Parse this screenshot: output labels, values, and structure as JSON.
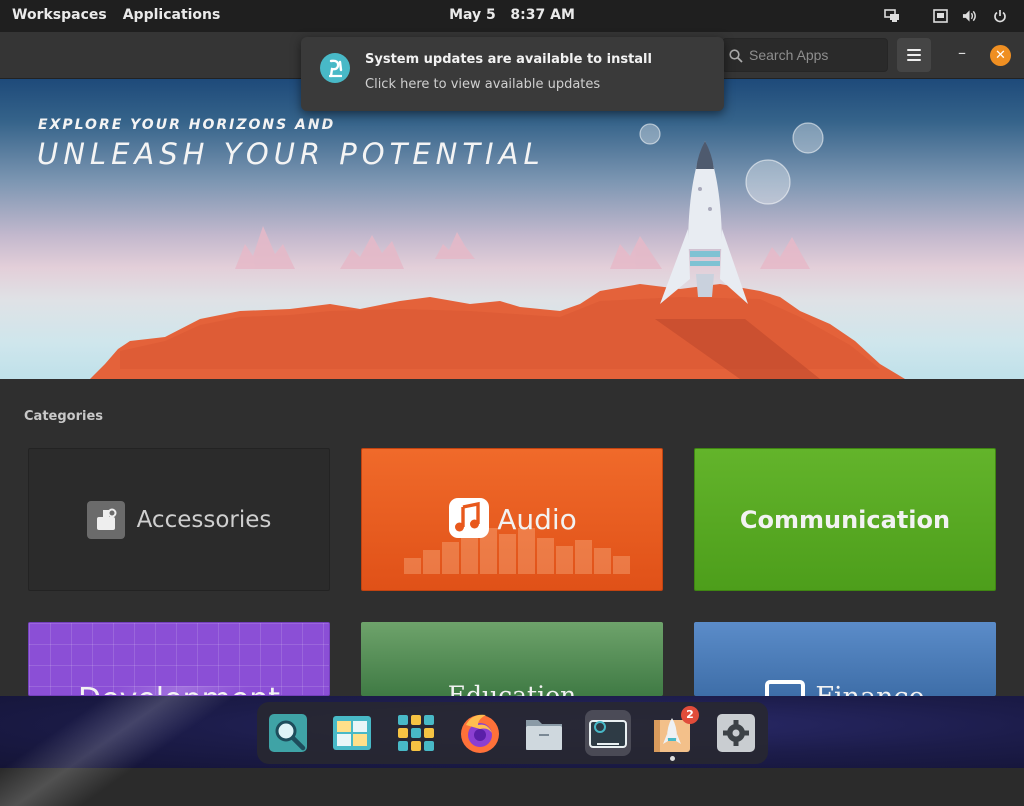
{
  "topbar": {
    "workspaces": "Workspaces",
    "applications": "Applications",
    "date": "May 5",
    "time": "8:37 AM"
  },
  "header": {
    "search_placeholder": "Search Apps"
  },
  "notification": {
    "title": "System updates are available to install",
    "body": "Click here to view available updates"
  },
  "banner": {
    "tagline_small": "EXPLORE YOUR HORIZONS AND",
    "tagline_large": "UNLEASH YOUR POTENTIAL"
  },
  "categories": {
    "heading": "Categories",
    "items": [
      {
        "label": "Accessories"
      },
      {
        "label": "Audio"
      },
      {
        "label": "Communication"
      },
      {
        "label": "Development"
      },
      {
        "label": "Education"
      },
      {
        "label": "Finance"
      }
    ]
  },
  "dock": {
    "updates_badge": "2",
    "icons": [
      "search-icon",
      "desktop-icon",
      "app-grid-icon",
      "firefox-icon",
      "files-icon",
      "screenshot-icon",
      "pop-shop-icon",
      "settings-icon"
    ]
  },
  "colors": {
    "accent": "#ef8f22",
    "audio_tile": "#e8581c",
    "communication_tile": "#58a923",
    "development_tile": "#8b4fd6",
    "education_tile": "#4f8c54",
    "finance_tile": "#4d7db9",
    "pop_teal": "#48b9c7"
  }
}
